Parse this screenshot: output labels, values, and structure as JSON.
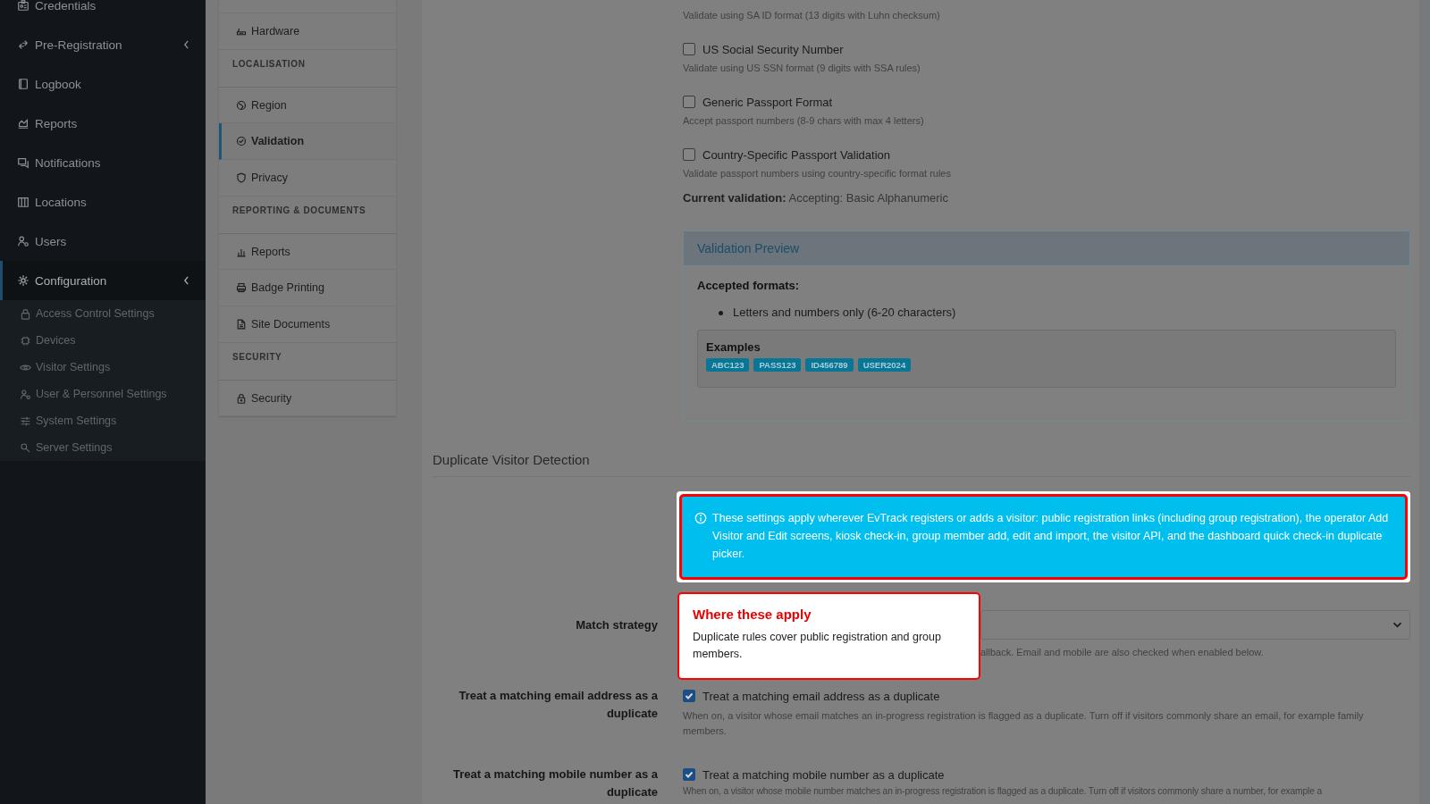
{
  "sidebar": {
    "items": [
      {
        "label": "Credentials",
        "selected": false,
        "has_submenu": false
      },
      {
        "label": "Pre-Registration",
        "selected": false,
        "has_submenu": true
      },
      {
        "label": "Logbook",
        "selected": false,
        "has_submenu": false
      },
      {
        "label": "Reports",
        "selected": false,
        "has_submenu": false
      },
      {
        "label": "Notifications",
        "selected": false,
        "has_submenu": false
      },
      {
        "label": "Locations",
        "selected": false,
        "has_submenu": false
      },
      {
        "label": "Users",
        "selected": false,
        "has_submenu": false
      },
      {
        "label": "Configuration",
        "selected": true,
        "has_submenu": true,
        "children": [
          {
            "label": "Access Control Settings",
            "selected": false
          },
          {
            "label": "Devices",
            "selected": false
          },
          {
            "label": "Visitor Settings",
            "selected": false
          },
          {
            "label": "User & Personnel Settings",
            "selected": false
          },
          {
            "label": "System Settings",
            "selected": false
          },
          {
            "label": "Server Settings",
            "selected": false
          }
        ]
      }
    ]
  },
  "settings_nav": {
    "items": [
      {
        "kind": "link",
        "label": "Hardware",
        "selected": false
      },
      {
        "kind": "heading",
        "label": "LOCALISATION"
      },
      {
        "kind": "link",
        "label": "Region",
        "selected": false
      },
      {
        "kind": "link",
        "label": "Validation",
        "selected": true
      },
      {
        "kind": "link",
        "label": "Privacy",
        "selected": false
      },
      {
        "kind": "heading",
        "label": "REPORTING & DOCUMENTS"
      },
      {
        "kind": "link",
        "label": "Reports",
        "selected": false
      },
      {
        "kind": "link",
        "label": "Badge Printing",
        "selected": false
      },
      {
        "kind": "link",
        "label": "Site Documents",
        "selected": false
      },
      {
        "kind": "heading",
        "label": "SECURITY"
      },
      {
        "kind": "link",
        "label": "Security",
        "selected": false
      }
    ]
  },
  "id_formats": [
    {
      "help": "Validate using SA ID format (13 digits with Luhn checksum)"
    },
    {
      "label": "US Social Security Number",
      "checked": false,
      "help": "Validate using US SSN format (9 digits with SSA rules)"
    },
    {
      "label": "Generic Passport Format",
      "checked": false,
      "help": "Accept passport numbers (8-9 chars with max 4 letters)"
    },
    {
      "label": "Country-Specific Passport Validation",
      "checked": false,
      "help": "Validate passport numbers using country-specific format rules"
    }
  ],
  "current_validation": {
    "label": "Current validation:",
    "value": "Accepting: Basic Alphanumeric"
  },
  "validation_preview": {
    "title": "Validation Preview",
    "formats_heading": "Accepted formats:",
    "formats": [
      "Letters and numbers only (6-20 characters)"
    ],
    "examples_heading": "Examples",
    "examples": [
      "ABC123",
      "PASS123",
      "ID456789",
      "USER2024"
    ]
  },
  "duplicate_detection": {
    "title": "Duplicate Visitor Detection",
    "info": "These settings apply wherever EvTrack registers or adds a visitor: public registration links (including group registration), the operator Add Visitor and Edit screens, kiosk check-in, group member add, edit and import, the visitor API, and the dashboard quick check-in duplicate picker.",
    "match_strategy": {
      "label": "Match strategy",
      "help": "allback. Email and mobile are also checked when enabled below."
    },
    "options": [
      {
        "label": "Treat a matching email address as a duplicate",
        "checkbox_label": "Treat a matching email address as a duplicate",
        "checked": true,
        "help": "When on, a visitor whose email matches an in-progress registration is flagged as a duplicate. Turn off if visitors commonly share an email, for example family members."
      },
      {
        "label": "Treat a matching mobile number as a duplicate",
        "checkbox_label": "Treat a matching mobile number as a duplicate",
        "checked": true,
        "help": "When on, a visitor whose mobile number matches an in-progress registration is flagged as a duplicate. Turn off if visitors commonly share a number, for example a"
      }
    ]
  },
  "tour_tooltip": {
    "title": "Where these apply",
    "text": "Duplicate rules cover public registration and group members."
  }
}
